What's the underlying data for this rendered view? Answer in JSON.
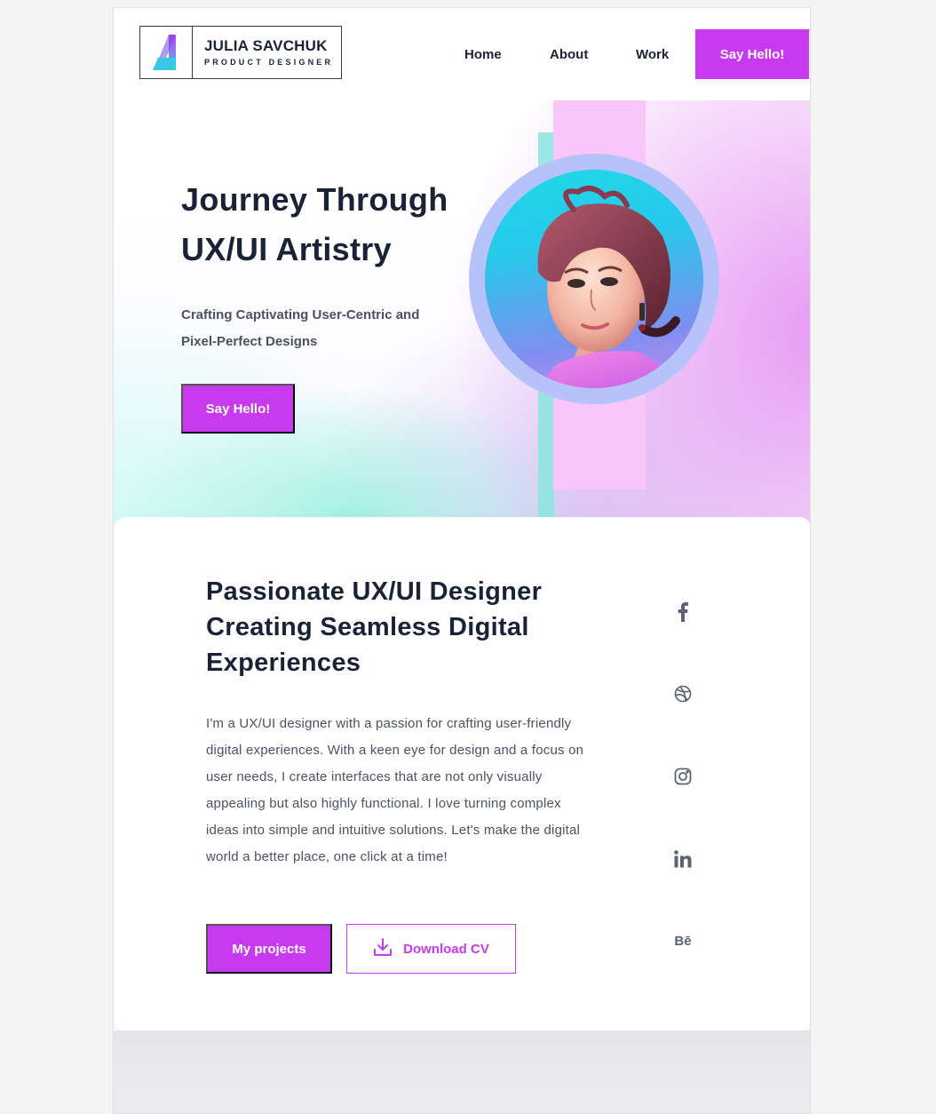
{
  "brand": {
    "name": "JULIA SAVCHUK",
    "role": "PRODUCT DESIGNER",
    "logo_icon": "stylized-letter-a-icon"
  },
  "nav": {
    "items": [
      {
        "label": "Home"
      },
      {
        "label": "About"
      },
      {
        "label": "Work"
      }
    ],
    "cta_label": "Say Hello!"
  },
  "hero": {
    "title_line1": "Journey Through",
    "title_line2": "UX/UI Artistry",
    "subtitle_line1": "Crafting Captivating User-Centric and",
    "subtitle_line2": "Pixel-Perfect Designs",
    "cta_label": "Say Hello!",
    "avatar_alt": "portrait-illustration"
  },
  "about": {
    "title": "Passionate UX/UI Designer Creating Seamless Digital Experiences",
    "body": "I'm a UX/UI designer with a passion for crafting user-friendly digital experiences. With a keen eye for design and a focus on user needs, I create interfaces that are not only visually appealing but also highly functional. I love turning complex ideas into simple and intuitive solutions. Let's make the digital world a better place, one click at a time!",
    "primary_button": "My projects",
    "secondary_button": "Download CV"
  },
  "socials": [
    {
      "name": "facebook-icon"
    },
    {
      "name": "dribbble-icon"
    },
    {
      "name": "instagram-icon"
    },
    {
      "name": "linkedin-icon"
    },
    {
      "name": "behance-icon",
      "label": "Bē"
    }
  ],
  "colors": {
    "accent": "#c83af0",
    "text_dark": "#1a2238",
    "text_muted": "#4a5263",
    "icon_gray": "#5b6273",
    "pink_stripe": "#f9c6fc",
    "teal_stripe": "#8fe6e0"
  }
}
